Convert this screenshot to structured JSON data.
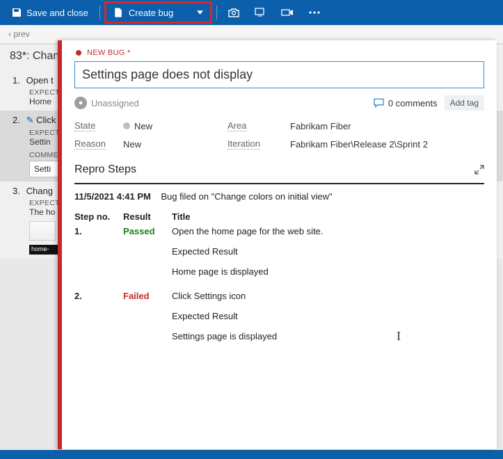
{
  "toolbar": {
    "save_close": "Save and close",
    "create_bug": "Create bug"
  },
  "breadcrumb": {
    "prev": "prev"
  },
  "header": {
    "title": "83*: Chan"
  },
  "bgSteps": [
    {
      "num": "1.",
      "title": "Open t",
      "exp": "EXPECTE",
      "expv": "Home"
    },
    {
      "num": "2.",
      "title": "Click S",
      "exp": "EXPECTE",
      "expv": "Settin",
      "comm": "COMME",
      "commv": "Setti"
    },
    {
      "num": "3.",
      "title": "Chang",
      "exp": "EXPECTE",
      "expv": "The ho",
      "dark": "home-"
    }
  ],
  "bug": {
    "badge": "NEW BUG *",
    "title": "Settings page does not display",
    "assignee": "Unassigned",
    "comments_count": "0 comments",
    "add_tag": "Add tag",
    "fields": {
      "state_lbl": "State",
      "state": "New",
      "reason_lbl": "Reason",
      "reason": "New",
      "area_lbl": "Area",
      "area": "Fabrikam Fiber",
      "iter_lbl": "Iteration",
      "iter": "Fabrikam Fiber\\Release 2\\Sprint 2"
    },
    "section": "Repro Steps",
    "repro": {
      "timestamp": "11/5/2021 4:41 PM",
      "context": "Bug filed on \"Change colors on initial view\"",
      "head_step": "Step no.",
      "head_result": "Result",
      "head_title": "Title",
      "rows": [
        {
          "num": "1.",
          "result": "Passed",
          "title": "Open the home page for the web site.",
          "exp_lbl": "Expected Result",
          "exp": "Home page is displayed"
        },
        {
          "num": "2.",
          "result": "Failed",
          "title": "Click Settings icon",
          "exp_lbl": "Expected Result",
          "exp": "Settings page is displayed"
        }
      ]
    }
  }
}
